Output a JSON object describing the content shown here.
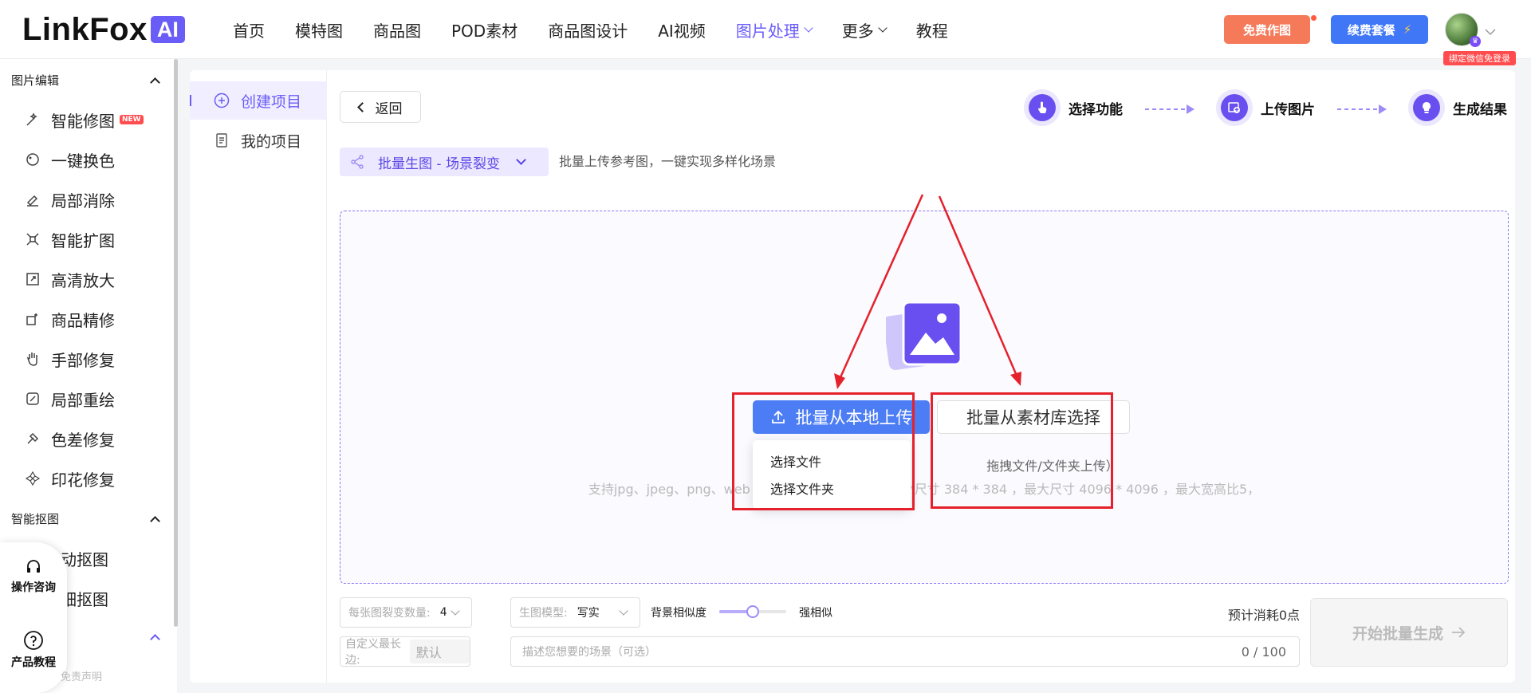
{
  "header": {
    "logo_text": "LinkFox",
    "logo_badge": "AI",
    "nav": [
      {
        "label": "首页"
      },
      {
        "label": "模特图"
      },
      {
        "label": "商品图"
      },
      {
        "label": "POD素材"
      },
      {
        "label": "商品图设计"
      },
      {
        "label": "AI视频"
      },
      {
        "label": "图片处理",
        "active": true,
        "dropdown": true
      },
      {
        "label": "更多",
        "dropdown": true
      },
      {
        "label": "教程"
      }
    ],
    "free_btn": "免费作图",
    "renew_btn": "续费套餐",
    "bind_tag": "绑定微信免登录"
  },
  "sidebar": {
    "section1": "图片编辑",
    "items1": [
      {
        "label": "智能修图",
        "icon": "magic-wand-icon",
        "badge": "NEW"
      },
      {
        "label": "一键换色",
        "icon": "palette-icon"
      },
      {
        "label": "局部消除",
        "icon": "eraser-icon"
      },
      {
        "label": "智能扩图",
        "icon": "expand-icon"
      },
      {
        "label": "高清放大",
        "icon": "upscale-icon"
      },
      {
        "label": "商品精修",
        "icon": "retouch-icon"
      },
      {
        "label": "手部修复",
        "icon": "hand-icon"
      },
      {
        "label": "局部重绘",
        "icon": "redraw-icon"
      },
      {
        "label": "色差修复",
        "icon": "color-fix-icon"
      },
      {
        "label": "印花修复",
        "icon": "print-fix-icon"
      }
    ],
    "section2": "智能抠图",
    "items2": [
      {
        "label": "动抠图"
      },
      {
        "label": "细抠图"
      }
    ],
    "float": {
      "consult": "操作咨询",
      "tutorial": "产品教程"
    },
    "disclaimer": "免责声明"
  },
  "projects": {
    "create": "创建项目",
    "mine": "我的项目"
  },
  "main": {
    "back": "返回",
    "steps": [
      "选择功能",
      "上传图片",
      "生成结果"
    ],
    "mode": "批量生图 - 场景裂变",
    "mode_desc": "批量上传参考图，一键实现多样化场景",
    "upload_local": "批量从本地上传",
    "upload_library": "批量从素材库选择",
    "dropdown": [
      "选择文件",
      "选择文件夹"
    ],
    "hint_line1": "拖拽文件/文件夹上传）",
    "hint_line2_left": "支持jpg、jpeg、png、web",
    "hint_line2_right": "小尺寸 384 * 384 ，最大尺寸 4096 * 4096 ，最大宽高比5，"
  },
  "controls": {
    "variants_label": "每张图裂变数量:",
    "variants_value": "4",
    "model_label": "生图模型:",
    "model_value": "写实",
    "similarity_label": "背景相似度",
    "similarity_value_label": "强相似",
    "similarity_level": 0.5,
    "cost": "预计消耗0点",
    "generate": "开始批量生成",
    "edge_label": "自定义最长边:",
    "edge_placeholder": "默认",
    "scene_placeholder": "描述您想要的场景（可选）",
    "scene_counter": "0 / 100"
  },
  "colors": {
    "accent": "#6a5cf7",
    "primary_blue": "#4d7df5",
    "annotation_red": "#e5212b",
    "free_btn": "#f47a5a"
  }
}
